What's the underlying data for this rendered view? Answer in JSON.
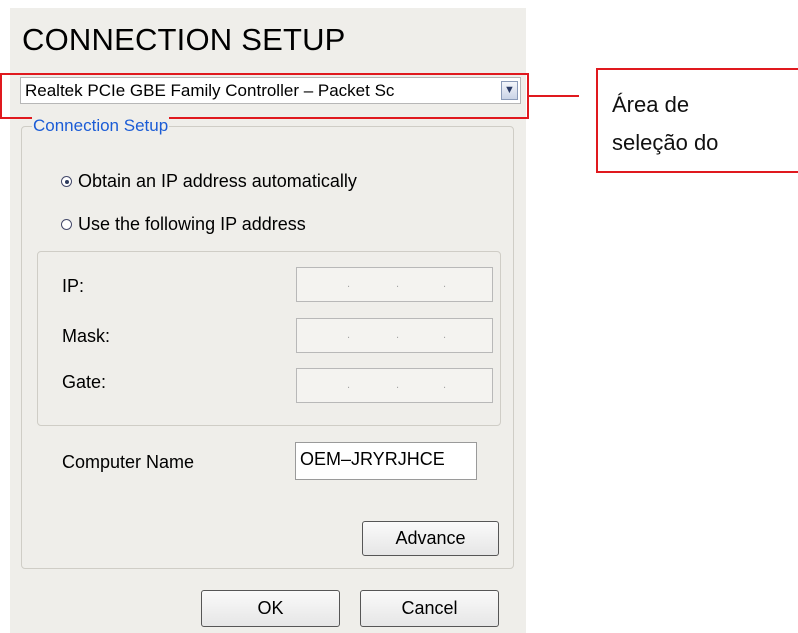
{
  "dialog": {
    "title": "CONNECTION SETUP",
    "adapter": {
      "value": "Realtek PCIe GBE Family Controller – Packet Sc",
      "dropdown_icon": "chevron-down-icon"
    },
    "group_title": "Connection Setup",
    "radios": [
      {
        "label": "Obtain an IP address automatically",
        "checked": true
      },
      {
        "label": "Use the following IP address",
        "checked": false
      }
    ],
    "fields": [
      {
        "label": "IP:",
        "dots": ".  .  ."
      },
      {
        "label": "Mask:",
        "dots": ".  .  ."
      },
      {
        "label": "Gate:",
        "dots": ".  .  ."
      }
    ],
    "computer_name": {
      "label": "Computer Name",
      "value": "OEM–JRYRJHCE"
    },
    "buttons": {
      "advance": "Advance",
      "ok": "OK",
      "cancel": "Cancel"
    }
  },
  "annotation": {
    "lines": [
      "Área de",
      "seleção do"
    ],
    "color": "#e0191e"
  }
}
